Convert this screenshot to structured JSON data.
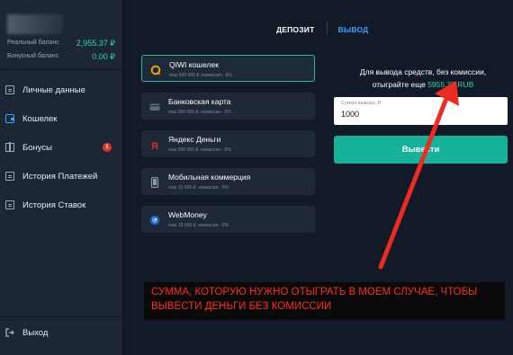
{
  "sidebar": {
    "balances": [
      {
        "label": "Реальный баланс",
        "value": "2,955.37 ₽"
      },
      {
        "label": "Бонусный баланс",
        "value": "0.00 ₽"
      }
    ],
    "items": [
      {
        "label": "Личные данные",
        "icon": "profile-card-icon"
      },
      {
        "label": "Кошелек",
        "icon": "wallet-icon"
      },
      {
        "label": "Бонусы",
        "icon": "gift-icon",
        "badge": "1"
      },
      {
        "label": "История Платежей",
        "icon": "payments-history-icon"
      },
      {
        "label": "История Ставок",
        "icon": "bets-history-icon"
      }
    ],
    "exit_label": "Выход"
  },
  "tabs": [
    {
      "label": "ДЕПОЗИТ"
    },
    {
      "label": "ВЫВОД"
    }
  ],
  "methods": [
    {
      "title": "QIWI кошелек",
      "sub": "max 500 000 ₽, комиссия - 5%",
      "icon": "qiwi-icon"
    },
    {
      "title": "Банковская карта",
      "sub": "max 500 000 ₽, комиссия - 5%",
      "icon": "bank-card-icon"
    },
    {
      "title": "Яндекс Деньги",
      "sub": "max 500 000 ₽, комиссия - 5%",
      "icon": "yandex-money-icon"
    },
    {
      "title": "Мобильная коммерция",
      "sub": "max 15 000 ₽, комиссия - 5%",
      "icon": "mobile-phone-icon"
    },
    {
      "title": "WebMoney",
      "sub": "max 15 000 ₽, комиссия - 5%",
      "icon": "webmoney-icon"
    }
  ],
  "withdraw": {
    "info_line1": "Для вывода средств, без комиссии,",
    "info_line2_prefix": "отыграйте еще",
    "info_amount": "5955.37 RUB",
    "amount_label": "Сумма вывода, ₽",
    "amount_value": "1000",
    "button_label": "Вывести"
  },
  "annotation": {
    "text": "СУММА, КОТОРУЮ НУЖНО ОТЫГРАТЬ В МОЕМ СЛУЧАЕ, ЧТОБЫ ВЫВЕСТИ ДЕНЬГИ БЕЗ КОМИССИИ"
  },
  "colors": {
    "accent": "#2fd3b4",
    "tab_active_blue": "#3d9cff",
    "annotation_red": "#ff2a1a",
    "button": "#15b198"
  }
}
